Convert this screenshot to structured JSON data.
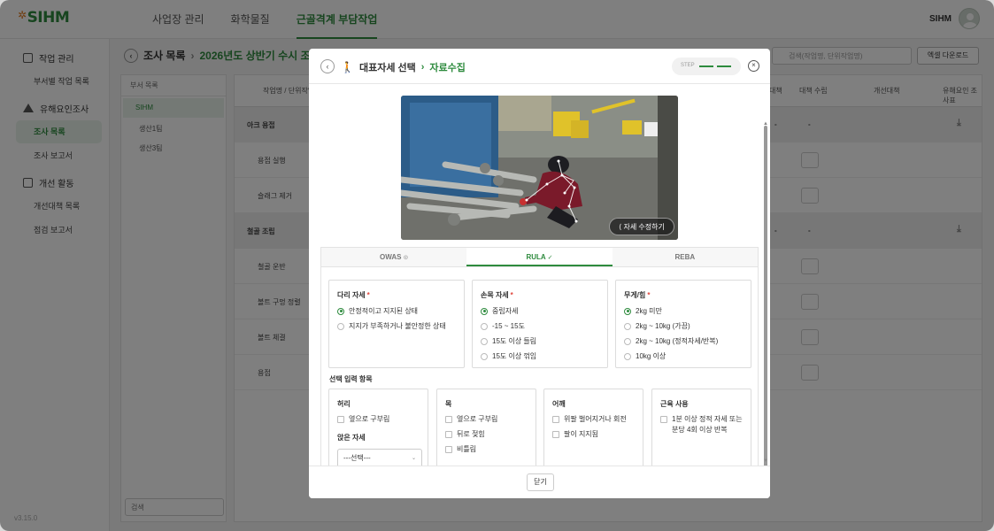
{
  "app": {
    "logo": "SIHM",
    "version": "v3.15.0"
  },
  "topnav": [
    {
      "label": "사업장 관리"
    },
    {
      "label": "화학물질"
    },
    {
      "label": "근골격계 부담작업"
    }
  ],
  "user": {
    "name": "SIHM"
  },
  "sidebar": {
    "groups": [
      {
        "label": "작업 관리",
        "items": [
          "부서별 작업 목록"
        ]
      },
      {
        "label": "유해요인조사",
        "items": [
          "조사 목록",
          "조사 보고서"
        ]
      },
      {
        "label": "개선 활동",
        "items": [
          "개선대책 목록",
          "점검 보고서"
        ]
      }
    ]
  },
  "background": {
    "breadcrumb": {
      "parent": "조사 목록",
      "current": "2026년도 상반기 수시 조사"
    },
    "search_placeholder": "검색(작업명, 단위작업명)",
    "excel_label": "엑셀 다운로드",
    "tree": {
      "header": "부서 목록",
      "items": [
        "SIHM",
        "생산1팀",
        "생산3팀"
      ],
      "search_placeholder": "검색"
    },
    "table": {
      "headers": [
        "작업명 / 단위작업",
        "대책",
        "대책 수립",
        "개선대책",
        "유해요인 조사표"
      ],
      "rows": [
        {
          "label": "아크 용접",
          "group": true,
          "dash1": "-",
          "dash2": "-"
        },
        {
          "label": "용접 실행",
          "group": false
        },
        {
          "label": "슬래그 제거",
          "group": false
        },
        {
          "label": "철골 조립",
          "group": true,
          "dash1": "-",
          "dash2": "-"
        },
        {
          "label": "철골 운반",
          "group": false
        },
        {
          "label": "볼트 구멍 정렬",
          "group": false
        },
        {
          "label": "볼트 체결",
          "group": false
        },
        {
          "label": "용접",
          "group": false
        }
      ]
    }
  },
  "modal": {
    "title": "대표자세 선택",
    "subtitle": "자료수집",
    "step_label": "STEP",
    "edit_pose_label": "자세 수정하기",
    "tabs": [
      {
        "label": "OWAS",
        "active": false
      },
      {
        "label": "RULA",
        "active": true
      },
      {
        "label": "REBA",
        "active": false
      }
    ],
    "required_cards": [
      {
        "title": "다리 자세",
        "options": [
          {
            "label": "안정적이고 지지된 상태",
            "selected": true
          },
          {
            "label": "지지가 부족하거나 불안정한 상태",
            "selected": false
          }
        ]
      },
      {
        "title": "손목 자세",
        "options": [
          {
            "label": "중립자세",
            "selected": true
          },
          {
            "label": "-15 ~ 15도",
            "selected": false
          },
          {
            "label": "15도 이상 들림",
            "selected": false
          },
          {
            "label": "15도 이상 꺾임",
            "selected": false
          }
        ]
      },
      {
        "title": "무게/힘",
        "options": [
          {
            "label": "2kg 미만",
            "selected": true
          },
          {
            "label": "2kg ~ 10kg (가끔)",
            "selected": false
          },
          {
            "label": "2kg ~ 10kg (정적자세/반복)",
            "selected": false
          },
          {
            "label": "10kg 이상",
            "selected": false
          }
        ]
      }
    ],
    "optional_title": "선택 입력 항목",
    "optional_cards": [
      {
        "title": "허리",
        "options": [
          "옆으로 구부림"
        ],
        "sub_title": "앉은 자세",
        "select_value": "---선택---"
      },
      {
        "title": "목",
        "options": [
          "옆으로 구부림",
          "뒤로 젖힘",
          "비틀림"
        ]
      },
      {
        "title": "어깨",
        "options": [
          "위팔 벌어지거나 회전",
          "팔이 지지됨"
        ]
      },
      {
        "title": "근육 사용",
        "options": [
          "1분 이상 정적 자세 또는\n분당 4회 이상 반복"
        ]
      }
    ],
    "close_label": "닫기"
  },
  "colors": {
    "brand": "#2e8b3e",
    "accent": "#e07b20",
    "required": "#e0463c"
  }
}
